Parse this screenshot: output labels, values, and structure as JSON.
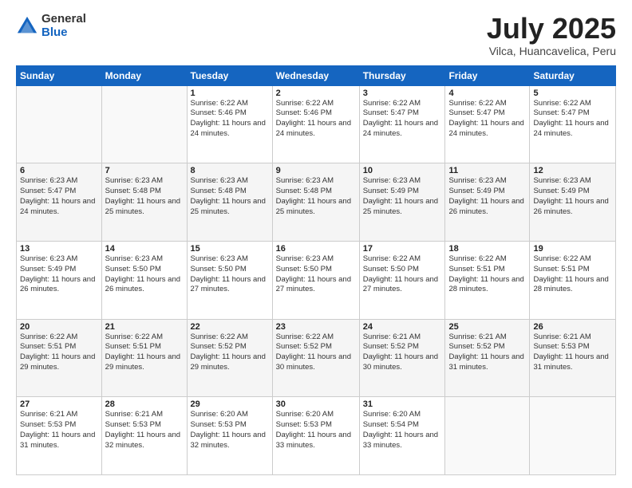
{
  "logo": {
    "general": "General",
    "blue": "Blue"
  },
  "header": {
    "title": "July 2025",
    "subtitle": "Vilca, Huancavelica, Peru"
  },
  "weekdays": [
    "Sunday",
    "Monday",
    "Tuesday",
    "Wednesday",
    "Thursday",
    "Friday",
    "Saturday"
  ],
  "weeks": [
    [
      {
        "day": "",
        "info": ""
      },
      {
        "day": "",
        "info": ""
      },
      {
        "day": "1",
        "info": "Sunrise: 6:22 AM\nSunset: 5:46 PM\nDaylight: 11 hours and 24 minutes."
      },
      {
        "day": "2",
        "info": "Sunrise: 6:22 AM\nSunset: 5:46 PM\nDaylight: 11 hours and 24 minutes."
      },
      {
        "day": "3",
        "info": "Sunrise: 6:22 AM\nSunset: 5:47 PM\nDaylight: 11 hours and 24 minutes."
      },
      {
        "day": "4",
        "info": "Sunrise: 6:22 AM\nSunset: 5:47 PM\nDaylight: 11 hours and 24 minutes."
      },
      {
        "day": "5",
        "info": "Sunrise: 6:22 AM\nSunset: 5:47 PM\nDaylight: 11 hours and 24 minutes."
      }
    ],
    [
      {
        "day": "6",
        "info": "Sunrise: 6:23 AM\nSunset: 5:47 PM\nDaylight: 11 hours and 24 minutes."
      },
      {
        "day": "7",
        "info": "Sunrise: 6:23 AM\nSunset: 5:48 PM\nDaylight: 11 hours and 25 minutes."
      },
      {
        "day": "8",
        "info": "Sunrise: 6:23 AM\nSunset: 5:48 PM\nDaylight: 11 hours and 25 minutes."
      },
      {
        "day": "9",
        "info": "Sunrise: 6:23 AM\nSunset: 5:48 PM\nDaylight: 11 hours and 25 minutes."
      },
      {
        "day": "10",
        "info": "Sunrise: 6:23 AM\nSunset: 5:49 PM\nDaylight: 11 hours and 25 minutes."
      },
      {
        "day": "11",
        "info": "Sunrise: 6:23 AM\nSunset: 5:49 PM\nDaylight: 11 hours and 26 minutes."
      },
      {
        "day": "12",
        "info": "Sunrise: 6:23 AM\nSunset: 5:49 PM\nDaylight: 11 hours and 26 minutes."
      }
    ],
    [
      {
        "day": "13",
        "info": "Sunrise: 6:23 AM\nSunset: 5:49 PM\nDaylight: 11 hours and 26 minutes."
      },
      {
        "day": "14",
        "info": "Sunrise: 6:23 AM\nSunset: 5:50 PM\nDaylight: 11 hours and 26 minutes."
      },
      {
        "day": "15",
        "info": "Sunrise: 6:23 AM\nSunset: 5:50 PM\nDaylight: 11 hours and 27 minutes."
      },
      {
        "day": "16",
        "info": "Sunrise: 6:23 AM\nSunset: 5:50 PM\nDaylight: 11 hours and 27 minutes."
      },
      {
        "day": "17",
        "info": "Sunrise: 6:22 AM\nSunset: 5:50 PM\nDaylight: 11 hours and 27 minutes."
      },
      {
        "day": "18",
        "info": "Sunrise: 6:22 AM\nSunset: 5:51 PM\nDaylight: 11 hours and 28 minutes."
      },
      {
        "day": "19",
        "info": "Sunrise: 6:22 AM\nSunset: 5:51 PM\nDaylight: 11 hours and 28 minutes."
      }
    ],
    [
      {
        "day": "20",
        "info": "Sunrise: 6:22 AM\nSunset: 5:51 PM\nDaylight: 11 hours and 29 minutes."
      },
      {
        "day": "21",
        "info": "Sunrise: 6:22 AM\nSunset: 5:51 PM\nDaylight: 11 hours and 29 minutes."
      },
      {
        "day": "22",
        "info": "Sunrise: 6:22 AM\nSunset: 5:52 PM\nDaylight: 11 hours and 29 minutes."
      },
      {
        "day": "23",
        "info": "Sunrise: 6:22 AM\nSunset: 5:52 PM\nDaylight: 11 hours and 30 minutes."
      },
      {
        "day": "24",
        "info": "Sunrise: 6:21 AM\nSunset: 5:52 PM\nDaylight: 11 hours and 30 minutes."
      },
      {
        "day": "25",
        "info": "Sunrise: 6:21 AM\nSunset: 5:52 PM\nDaylight: 11 hours and 31 minutes."
      },
      {
        "day": "26",
        "info": "Sunrise: 6:21 AM\nSunset: 5:53 PM\nDaylight: 11 hours and 31 minutes."
      }
    ],
    [
      {
        "day": "27",
        "info": "Sunrise: 6:21 AM\nSunset: 5:53 PM\nDaylight: 11 hours and 31 minutes."
      },
      {
        "day": "28",
        "info": "Sunrise: 6:21 AM\nSunset: 5:53 PM\nDaylight: 11 hours and 32 minutes."
      },
      {
        "day": "29",
        "info": "Sunrise: 6:20 AM\nSunset: 5:53 PM\nDaylight: 11 hours and 32 minutes."
      },
      {
        "day": "30",
        "info": "Sunrise: 6:20 AM\nSunset: 5:53 PM\nDaylight: 11 hours and 33 minutes."
      },
      {
        "day": "31",
        "info": "Sunrise: 6:20 AM\nSunset: 5:54 PM\nDaylight: 11 hours and 33 minutes."
      },
      {
        "day": "",
        "info": ""
      },
      {
        "day": "",
        "info": ""
      }
    ]
  ]
}
